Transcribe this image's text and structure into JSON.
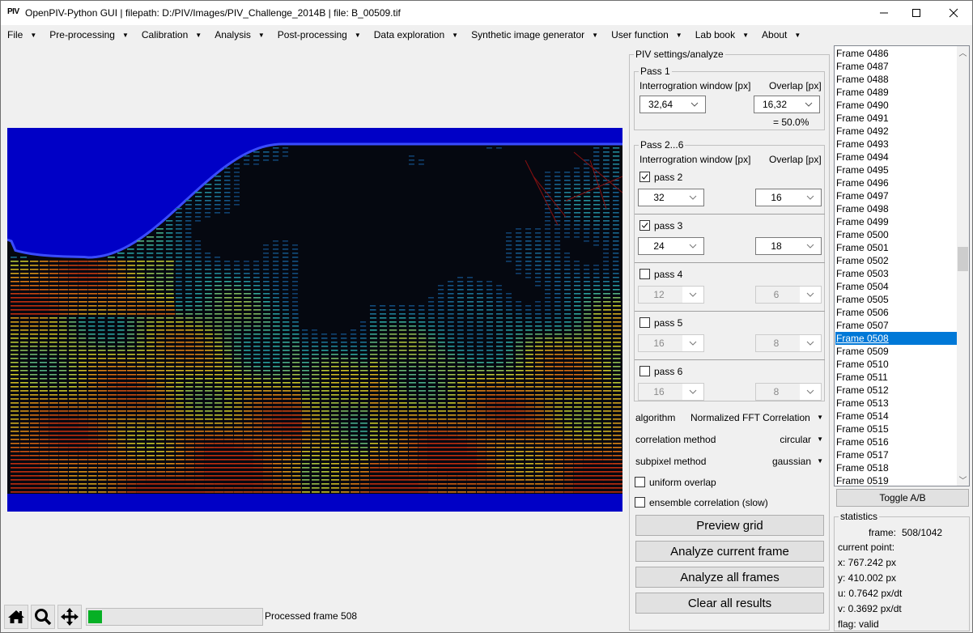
{
  "window": {
    "app_icon_text": "PIV",
    "title": "OpenPIV-Python GUI | filepath: D:/PIV/Images/PIV_Challenge_2014B | file: B_00509.tif",
    "controls": {
      "minimize": "—",
      "maximize": "☐",
      "close": "✕"
    }
  },
  "menubar": {
    "items": [
      {
        "label": "File"
      },
      {
        "label": "Pre-processing"
      },
      {
        "label": "Calibration"
      },
      {
        "label": "Analysis"
      },
      {
        "label": "Post-processing"
      },
      {
        "label": "Data exploration"
      },
      {
        "label": "Synthetic image generator"
      },
      {
        "label": "User function"
      },
      {
        "label": "Lab book"
      },
      {
        "label": "About"
      }
    ],
    "dropdown_glyph": "▼"
  },
  "plot": {
    "description": "PIV vector field overlay on particle image",
    "colors": {
      "background": "#0000c6",
      "interface": "#3a4cff",
      "fluid_dark": "#050810",
      "fast": "#c83a10",
      "medium": "#d9c21a",
      "slow": "#2aa6a0"
    }
  },
  "toolbar": {
    "home_icon": "home",
    "zoom_icon": "magnifier",
    "pan_icon": "move-arrows",
    "progress_fraction": 0.08,
    "progress_color": "#06b025",
    "status_text": "Processed frame 508"
  },
  "settings": {
    "group_title": "PIV settings/analyze",
    "pass1": {
      "title": "Pass 1",
      "window_label": "Interrogration window [px]",
      "overlap_label": "Overlap [px]",
      "window_value": "32,64",
      "overlap_value": "16,32",
      "overlap_percent": "= 50.0%"
    },
    "passes": {
      "title": "Pass 2...6",
      "window_label": "Interrogration window [px]",
      "overlap_label": "Overlap [px]",
      "items": [
        {
          "label": "pass 2",
          "checked": true,
          "window": "32",
          "overlap": "16"
        },
        {
          "label": "pass 3",
          "checked": true,
          "window": "24",
          "overlap": "18"
        },
        {
          "label": "pass 4",
          "checked": false,
          "window": "12",
          "overlap": "6"
        },
        {
          "label": "pass 5",
          "checked": false,
          "window": "16",
          "overlap": "8"
        },
        {
          "label": "pass 6",
          "checked": false,
          "window": "16",
          "overlap": "8"
        }
      ]
    },
    "algorithm": {
      "label": "algorithm",
      "value": "Normalized FFT Correlation"
    },
    "correlation_method": {
      "label": "correlation method",
      "value": "circular"
    },
    "subpixel_method": {
      "label": "subpixel method",
      "value": "gaussian"
    },
    "uniform_overlap": {
      "label": "uniform overlap",
      "checked": false
    },
    "ensemble_correlation": {
      "label": "ensemble correlation (slow)",
      "checked": false
    },
    "buttons": {
      "preview_grid": "Preview grid",
      "analyze_current": "Analyze current frame",
      "analyze_all": "Analyze all frames",
      "clear_all": "Clear all results"
    }
  },
  "frames": {
    "items": [
      "Frame 0486",
      "Frame 0487",
      "Frame 0488",
      "Frame 0489",
      "Frame 0490",
      "Frame 0491",
      "Frame 0492",
      "Frame 0493",
      "Frame 0494",
      "Frame 0495",
      "Frame 0496",
      "Frame 0497",
      "Frame 0498",
      "Frame 0499",
      "Frame 0500",
      "Frame 0501",
      "Frame 0502",
      "Frame 0503",
      "Frame 0504",
      "Frame 0505",
      "Frame 0506",
      "Frame 0507",
      "Frame 0508",
      "Frame 0509",
      "Frame 0510",
      "Frame 0511",
      "Frame 0512",
      "Frame 0513",
      "Frame 0514",
      "Frame 0515",
      "Frame 0516",
      "Frame 0517",
      "Frame 0518",
      "Frame 0519"
    ],
    "selected": "Frame 0508",
    "selection_color": "#0078d7",
    "toggle_label": "Toggle A/B"
  },
  "statistics": {
    "title": "statistics",
    "frame_label": "frame:",
    "frame_value": "508/1042",
    "current_point_label": "current point:",
    "x": "x:  767.242 px",
    "y": "y:  410.002 px",
    "u": "u:  0.7642 px/dt",
    "v": "v:  0.3692 px/dt",
    "flag": "flag:  valid"
  }
}
